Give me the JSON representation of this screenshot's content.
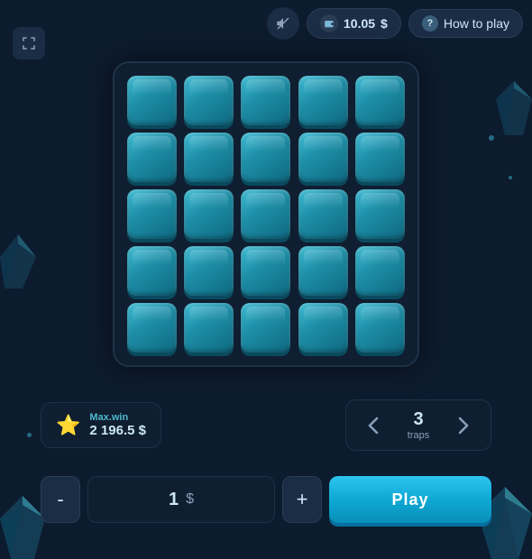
{
  "header": {
    "mute_icon": "🔇",
    "balance_icon": "💳",
    "balance_value": "10.05",
    "balance_currency": "$",
    "help_icon": "?",
    "how_to_play_label": "How to play"
  },
  "fullscreen": {
    "icon": "⛶"
  },
  "grid": {
    "rows": 5,
    "cols": 5,
    "total_cells": 25
  },
  "max_win": {
    "label": "Max.win",
    "value": "2 196.5",
    "currency": "$",
    "icon": "⭐"
  },
  "traps": {
    "label": "traps",
    "value": "3",
    "prev_icon": "‹",
    "next_icon": "›"
  },
  "bet": {
    "value": "1",
    "currency": "$",
    "minus_label": "-",
    "plus_label": "+"
  },
  "play_button": {
    "label": "Play"
  }
}
